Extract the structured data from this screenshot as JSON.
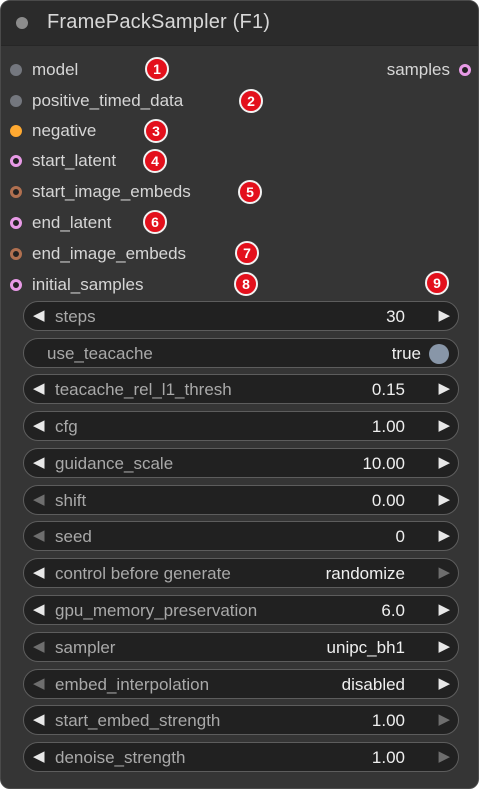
{
  "node": {
    "title": "FramePackSampler (F1)",
    "output": {
      "label": "samples",
      "color": "#e79ae6"
    },
    "inputs": [
      {
        "label": "model",
        "color": "#74777e",
        "badge": "1"
      },
      {
        "label": "positive_timed_data",
        "color": "#74777e",
        "badge": "2"
      },
      {
        "label": "negative",
        "color": "#ffa931",
        "badge": "3"
      },
      {
        "label": "start_latent",
        "color": "#e79ae6",
        "badge": "4"
      },
      {
        "label": "start_image_embeds",
        "color": "#b07050",
        "badge": "5"
      },
      {
        "label": "end_latent",
        "color": "#e79ae6",
        "badge": "6"
      },
      {
        "label": "end_image_embeds",
        "color": "#b07050",
        "badge": "7"
      },
      {
        "label": "initial_samples",
        "color": "#e79ae6",
        "badge": "8"
      }
    ],
    "extra_badge": "9",
    "widgets": [
      {
        "label": "steps",
        "value": "30",
        "left": "◀",
        "right": "▶"
      },
      {
        "label": "use_teacache",
        "value": "true",
        "toggle": true
      },
      {
        "label": "teacache_rel_l1_thresh",
        "value": "0.15",
        "left": "◀",
        "right": "▶"
      },
      {
        "label": "cfg",
        "value": "1.00",
        "left": "◀",
        "right": "▶"
      },
      {
        "label": "guidance_scale",
        "value": "10.00",
        "left": "◀",
        "right": "▶"
      },
      {
        "label": "shift",
        "value": "0.00",
        "left": "◀",
        "right": "▶"
      },
      {
        "label": "seed",
        "value": "0",
        "left": "◀",
        "right": "▶"
      },
      {
        "label": "control before generate",
        "value": "randomize",
        "left": "◀",
        "right": "▶"
      },
      {
        "label": "gpu_memory_preservation",
        "value": "6.0",
        "left": "◀",
        "right": "▶"
      },
      {
        "label": "sampler",
        "value": "unipc_bh1",
        "left": "◀",
        "right": "▶"
      },
      {
        "label": "embed_interpolation",
        "value": "disabled",
        "left": "◀",
        "right": "▶"
      },
      {
        "label": "start_embed_strength",
        "value": "1.00",
        "left": "◀",
        "right": "▶"
      },
      {
        "label": "denoise_strength",
        "value": "1.00",
        "left": "◀",
        "right": "▶"
      }
    ]
  },
  "colors": {
    "node_bg": "#353535",
    "title_bg": "#2b2b2b",
    "widget_bg": "#212121",
    "badge": "#e3101c",
    "toggle_knob": "#8896a8"
  }
}
